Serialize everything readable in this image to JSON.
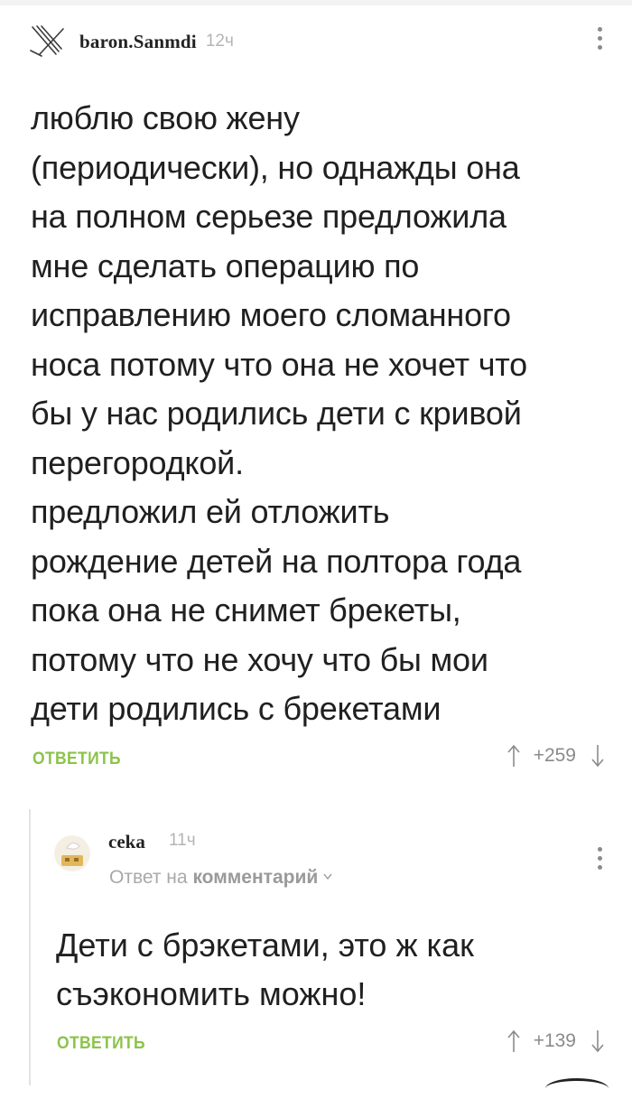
{
  "comment": {
    "username": "baron.Sanmdi",
    "time": "12ч",
    "avatar_icon": "crossed-swords-icon",
    "text": "люблю свою жену\n(периодически), но однажды она\nна полном серьезе предложила\nмне сделать операцию по\nисправлению моего сломанного\nноса потому что она не хочет что\nбы у нас родились дети с кривой\nперегородкой.\nпредложил ей отложить\nрождение детей на полтора года\nпока она не снимет брекеты,\nпотому что не хочу что бы мои\nдети родились с брекетами",
    "reply_label": "ОТВЕТИТЬ",
    "rating": "+259"
  },
  "reply": {
    "username": "ceka",
    "time": "11ч",
    "avatar_icon": "cartoon-avatar-icon",
    "reply_to_prefix": "Ответ на",
    "reply_to_link": "комментарий",
    "text": "Дети с брэкетами, это ж как\nсъэкономить можно!",
    "reply_label": "ОТВЕТИТЬ",
    "rating": "+139"
  },
  "colors": {
    "accent_green": "#8bc34a",
    "muted_gray": "#8a8a8a",
    "text": "#202020"
  }
}
